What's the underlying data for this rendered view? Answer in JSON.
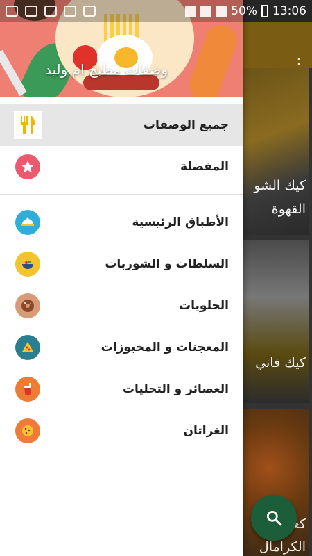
{
  "status_bar": {
    "battery": "50%",
    "time": "13:06"
  },
  "drawer": {
    "header_title": "وصفات مطبخ ام وليد",
    "primary_items": [
      {
        "label": "جميع الوصفات",
        "icon": "fork-knife-icon",
        "icon_bg": "#ffffff",
        "selected": true
      },
      {
        "label": "المفضلة",
        "icon": "star-icon",
        "icon_bg": "#e95a6f",
        "selected": false
      }
    ],
    "category_items": [
      {
        "label": "الأطباق الرئيسية",
        "icon": "serving-dish-icon",
        "icon_bg": "#2eaed8"
      },
      {
        "label": "السلطات و الشوربات",
        "icon": "soup-bowl-icon",
        "icon_bg": "#f4c430"
      },
      {
        "label": "الحلويات",
        "icon": "donut-icon",
        "icon_bg": "#d89a77"
      },
      {
        "label": "المعجنات و المخبوزات",
        "icon": "pizza-slice-icon",
        "icon_bg": "#2a7f8f"
      },
      {
        "label": "العصائر و التحليات",
        "icon": "juice-cup-icon",
        "icon_bg": "#ef7c34"
      },
      {
        "label": "الغراتان",
        "icon": "cookie-icon",
        "icon_bg": "#f07a37"
      }
    ]
  },
  "background": {
    "cards": [
      {
        "caption_line1": "كيك الشو",
        "caption_line2": "القهوة"
      },
      {
        "caption_line1": "كيك فاني",
        "caption_line2": ""
      },
      {
        "caption_line1": "كعكة بر",
        "caption_line2": "الكرامال"
      }
    ],
    "fab_icon": "search-icon"
  }
}
